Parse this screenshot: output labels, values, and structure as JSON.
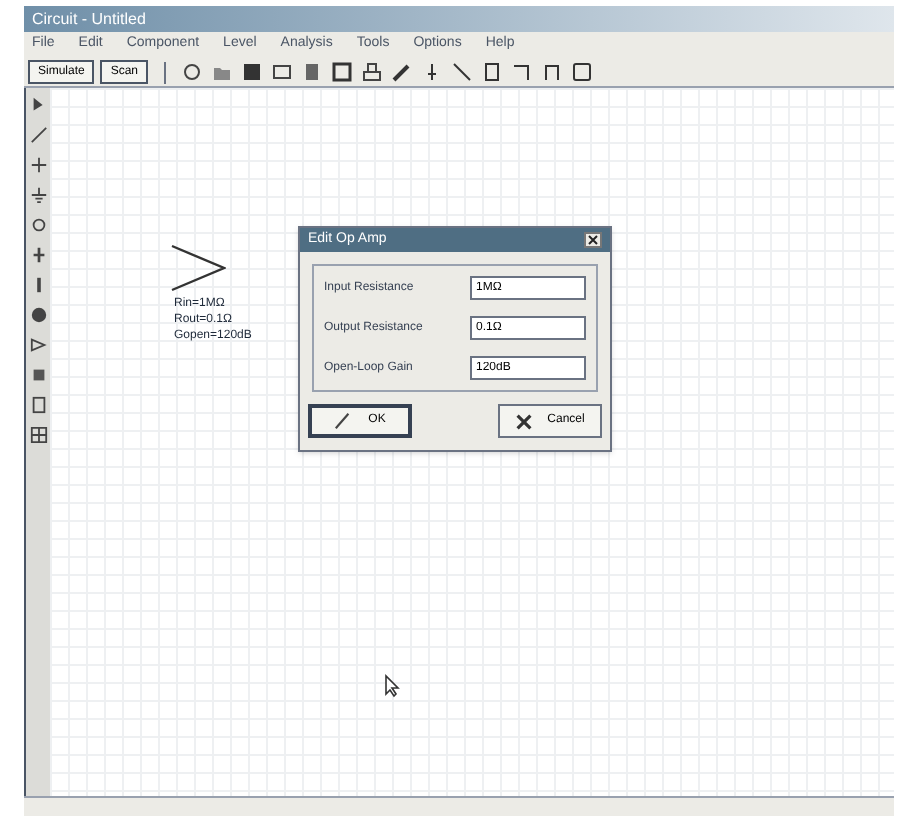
{
  "window": {
    "title": "Circuit - Untitled"
  },
  "menu": [
    "File",
    "Edit",
    "Component",
    "Level",
    "Analysis",
    "Tools",
    "Options",
    "Help"
  ],
  "toolbar": {
    "buttons": [
      "Simulate",
      "Scan"
    ]
  },
  "canvas": {
    "component_labels": [
      "Rin=1MΩ",
      "Rout=0.1Ω",
      "Gopen=120dB"
    ]
  },
  "dialog": {
    "title": "Edit Op Amp",
    "fields": [
      {
        "label": "Input Resistance",
        "value": "1MΩ"
      },
      {
        "label": "Output Resistance",
        "value": "0.1Ω"
      },
      {
        "label": "Open-Loop Gain",
        "value": "120dB"
      }
    ],
    "buttons": [
      {
        "label": "OK",
        "kind": "ok"
      },
      {
        "label": "Cancel",
        "kind": "cancel"
      }
    ]
  }
}
